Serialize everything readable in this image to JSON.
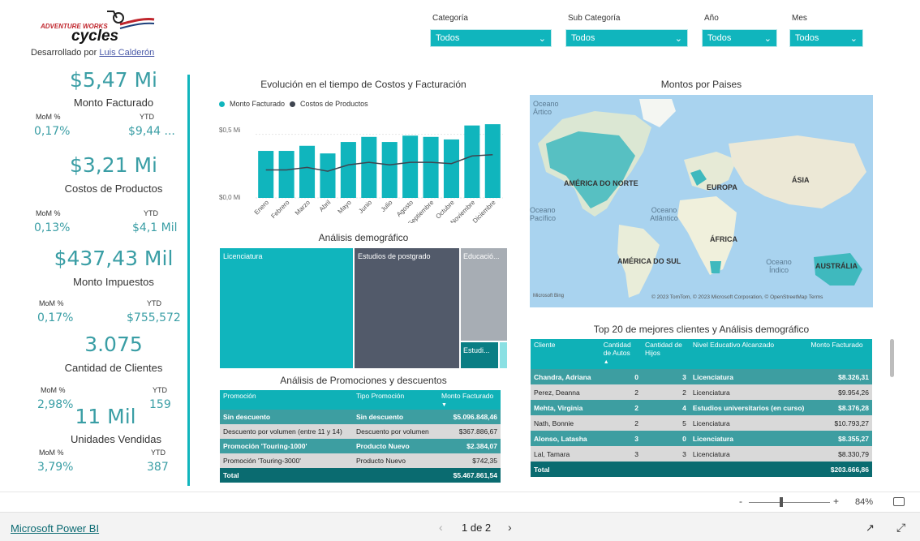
{
  "header": {
    "logo_line1": "ADVENTURE WORKS",
    "logo_line2": "cycles",
    "dev_prefix": "Desarrollado por",
    "dev_name": "Luis Calderón"
  },
  "slicers": [
    {
      "label": "Categoría",
      "value": "Todos"
    },
    {
      "label": "Sub Categoría",
      "value": "Todos"
    },
    {
      "label": "Año",
      "value": "Todos"
    },
    {
      "label": "Mes",
      "value": "Todos"
    }
  ],
  "kpis": [
    {
      "value": "$5,47 Mi",
      "label": "Monto Facturado",
      "mom_label": "MoM %",
      "mom": "0,17%",
      "ytd_label": "YTD",
      "ytd": "$9,44 ..."
    },
    {
      "value": "$3,21 Mi",
      "label": "Costos de Productos",
      "mom_label": "MoM %",
      "mom": "0,13%",
      "ytd_label": "YTD",
      "ytd": "$4,1 Mil"
    },
    {
      "value": "$437,43 Mil",
      "label": "Monto Impuestos",
      "mom_label": "MoM %",
      "mom": "0,17%",
      "ytd_label": "YTD",
      "ytd": "$755,572"
    },
    {
      "value": "3.075",
      "label": "Cantidad de Clientes",
      "mom_label": "MoM %",
      "mom": "2,98%",
      "ytd_label": "YTD",
      "ytd": "159"
    },
    {
      "value": "11 Mil",
      "label": "Unidades Vendidas",
      "mom_label": "MoM %",
      "mom": "3,79%",
      "ytd_label": "YTD",
      "ytd": "387"
    }
  ],
  "combo_chart": {
    "title": "Evolución en el tiempo de Costos y Facturación",
    "legend": [
      "Monto Facturado",
      "Costos de Productos"
    ],
    "ytick_top": "$0,5 Mi",
    "ytick_bottom": "$0,0 Mi"
  },
  "chart_data": {
    "type": "bar",
    "title": "Evolución en el tiempo de Costos y Facturación",
    "categories": [
      "Enero",
      "Febrero",
      "Marzo",
      "Abril",
      "Mayo",
      "Junio",
      "Julio",
      "Agosto",
      "Septiembre",
      "Octubre",
      "Noviembre",
      "Diciembre"
    ],
    "series": [
      {
        "name": "Monto Facturado",
        "type": "bar",
        "values": [
          0.37,
          0.37,
          0.41,
          0.35,
          0.44,
          0.48,
          0.44,
          0.49,
          0.48,
          0.46,
          0.57,
          0.58
        ]
      },
      {
        "name": "Costos de Productos",
        "type": "line",
        "values": [
          0.22,
          0.22,
          0.24,
          0.21,
          0.26,
          0.28,
          0.26,
          0.28,
          0.28,
          0.27,
          0.33,
          0.34
        ]
      }
    ],
    "ylim": [
      0,
      0.6
    ],
    "colors": {
      "bar": "#10b5bd",
      "line": "#3f4550"
    }
  },
  "demografico": {
    "title": "Análisis demográfico",
    "tiles": [
      "Licenciatura",
      "Estudios de postgrado",
      "Educació...",
      "Estudi..."
    ]
  },
  "map": {
    "title": "Montos por Paises",
    "labels": [
      "Oceano Ártico",
      "AMÉRICA DO NORTE",
      "EUROPA",
      "ÁSIA",
      "Oceano Pacífico",
      "Oceano Atlântico",
      "ÁFRICA",
      "AMÉRICA DO SUL",
      "Oceano Índico",
      "AUSTRÁLIA"
    ],
    "provider": "Microsoft Bing",
    "copyright": "© 2023 TomTom, © 2023 Microsoft Corporation, © OpenStreetMap  Terms"
  },
  "promo_table": {
    "title": "Análisis de Promociones y descuentos",
    "headers": [
      "Promoción",
      "Tipo Promoción",
      "Monto Facturado"
    ],
    "rows": [
      [
        "Sin descuento",
        "Sin descuento",
        "$5.096.848,46"
      ],
      [
        "Descuento por volumen (entre 11 y 14)",
        "Descuento por volumen",
        "$367.886,67"
      ],
      [
        "Promoción 'Touring-1000'",
        "Producto Nuevo",
        "$2.384,07"
      ],
      [
        "Promoción 'Touring-3000'",
        "Producto Nuevo",
        "$742,35"
      ]
    ],
    "total_label": "Total",
    "total_value": "$5.467.861,54"
  },
  "client_table": {
    "title": "Top 20 de mejores clientes y Análisis demográfico",
    "headers": [
      "Cliente",
      "Cantidad de Autos",
      "Cantidad de Hijos",
      "Nivel Educativo Alcanzado",
      "Monto Facturado"
    ],
    "rows": [
      [
        "Chandra, Adriana",
        "0",
        "3",
        "Licenciatura",
        "$8.326,31"
      ],
      [
        "Perez, Deanna",
        "2",
        "2",
        "Licenciatura",
        "$9.954,26"
      ],
      [
        "Mehta, Virginia",
        "2",
        "4",
        "Estudios universitarios (en curso)",
        "$8.376,28"
      ],
      [
        "Nath, Bonnie",
        "2",
        "5",
        "Licenciatura",
        "$10.793,27"
      ],
      [
        "Alonso, Latasha",
        "3",
        "0",
        "Licenciatura",
        "$8.355,27"
      ],
      [
        "Lal, Tamara",
        "3",
        "3",
        "Licenciatura",
        "$8.330,79"
      ]
    ],
    "total_label": "Total",
    "total_value": "$203.666,86"
  },
  "zoom": {
    "minus": "-",
    "plus": "+",
    "level": "84%"
  },
  "footer": {
    "brand": "Microsoft Power BI",
    "page": "1 de 2"
  }
}
